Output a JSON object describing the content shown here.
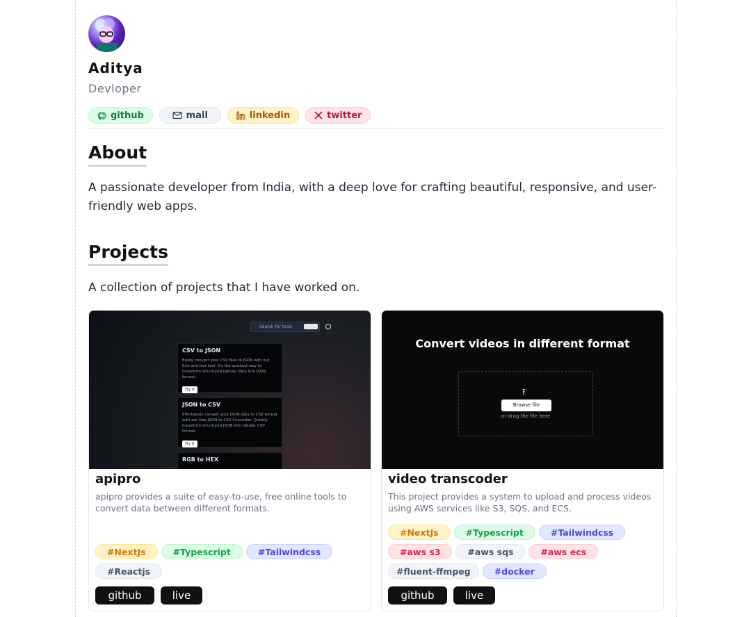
{
  "profile": {
    "name": "Aditya",
    "role": "Devloper"
  },
  "socials": [
    {
      "label": "github",
      "icon": "github-icon"
    },
    {
      "label": "mail",
      "icon": "mail-icon"
    },
    {
      "label": "linkedin",
      "icon": "linkedin-icon"
    },
    {
      "label": "twitter",
      "icon": "x-icon"
    }
  ],
  "about": {
    "heading": "About",
    "text": "A passionate developer from India, with a deep love for crafting beautiful, responsive, and user-friendly web apps."
  },
  "projects": {
    "heading": "Projects",
    "intro": "A collection of projects that I have worked on.",
    "items": [
      {
        "title": "apipro",
        "description": "apipro provides a suite of easy-to-use, free online tools to convert data between different formats.",
        "tags": [
          "#NextJs",
          "#Typescript",
          "#Tailwindcss",
          "#Reactjs"
        ],
        "github_label": "github",
        "live_label": "live",
        "thumb": {
          "search_placeholder": "Search for tools",
          "tools": [
            {
              "name": "CSV to JSON",
              "desc": "Easily convert your CSV files to JSON with our free and fast tool. It's the quickest way to transform structured tabular data into JSON format.",
              "button": "Try it"
            },
            {
              "name": "JSON to CSV",
              "desc": "Effortlessly convert your JSON data to CSV format with our free JSON to CSV Converter. Quickly transform structured JSON into tabular CSV format.",
              "button": "Try it"
            },
            {
              "name": "RGB to HEX",
              "desc": "",
              "button": ""
            }
          ]
        }
      },
      {
        "title": "video transcoder",
        "description": "This project provides a system to upload and process videos using AWS services like S3, SQS, and ECS.",
        "tags": [
          "#NextJs",
          "#Typescript",
          "#Tailwindcss",
          "#aws s3",
          "#aws sqs",
          "#aws ecs",
          "#fluent-ffmpeg",
          "#docker"
        ],
        "github_label": "github",
        "live_label": "live",
        "thumb": {
          "heading": "Convert videos in different format",
          "browse": "Browse file",
          "drag": "or drag the file here"
        }
      }
    ]
  }
}
